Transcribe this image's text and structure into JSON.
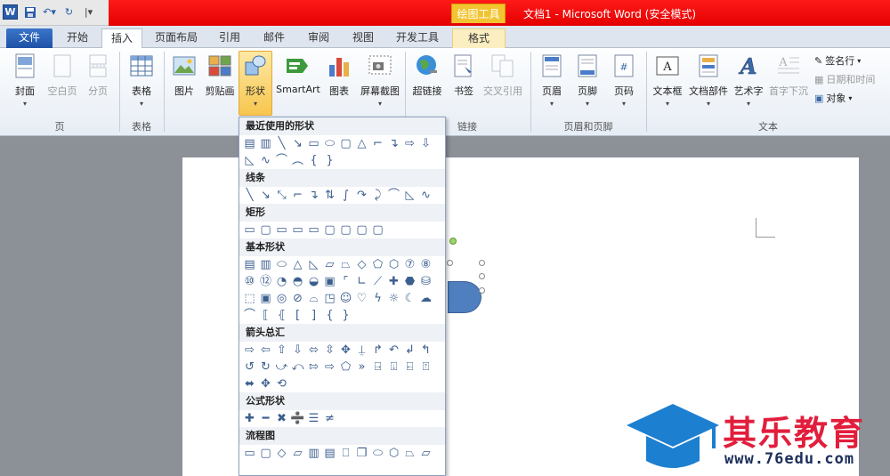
{
  "window": {
    "title": "文档1 - Microsoft Word (安全模式)",
    "context_header": "绘图工具"
  },
  "colors": {
    "titlebar_red": "#e40000",
    "context_yellow": "#f2c430",
    "file_tab_blue": "#2a5caa",
    "shape_fill": "#4f7fbf",
    "watermark_red": "#e21e3c",
    "watermark_navy": "#1c2e5a"
  },
  "tabs": [
    {
      "label": "文件",
      "state": "file"
    },
    {
      "label": "开始",
      "state": "normal"
    },
    {
      "label": "插入",
      "state": "active"
    },
    {
      "label": "页面布局",
      "state": "normal"
    },
    {
      "label": "引用",
      "state": "normal"
    },
    {
      "label": "邮件",
      "state": "normal"
    },
    {
      "label": "审阅",
      "state": "normal"
    },
    {
      "label": "视图",
      "state": "normal"
    },
    {
      "label": "开发工具",
      "state": "normal"
    },
    {
      "label": "格式",
      "state": "contextual"
    }
  ],
  "ribbon": {
    "pages_group": {
      "label": "页",
      "buttons": [
        "封面",
        "空白页",
        "分页"
      ]
    },
    "tables_group": {
      "label": "表格",
      "buttons": [
        "表格"
      ]
    },
    "illustrations": {
      "buttons": [
        "图片",
        "剪贴画",
        "形状",
        "SmartArt",
        "图表",
        "屏幕截图"
      ]
    },
    "links_group": {
      "label": "链接",
      "buttons": [
        "超链接",
        "书签",
        "交叉引用"
      ]
    },
    "header_footer_group": {
      "label": "页眉和页脚",
      "buttons": [
        "页眉",
        "页脚",
        "页码"
      ]
    },
    "text_group": {
      "label": "文本",
      "buttons": [
        "文本框",
        "文档部件",
        "艺术字",
        "首字下沉"
      ],
      "small": [
        "签名行",
        "日期和时间",
        "对象"
      ]
    }
  },
  "shapes_menu": {
    "sections": [
      {
        "title": "最近使用的形状"
      },
      {
        "title": "线条"
      },
      {
        "title": "矩形"
      },
      {
        "title": "基本形状"
      },
      {
        "title": "箭头总汇"
      },
      {
        "title": "公式形状"
      },
      {
        "title": "流程图"
      }
    ]
  },
  "watermark": {
    "name": "其乐教育",
    "url": "www.76edu.com"
  }
}
